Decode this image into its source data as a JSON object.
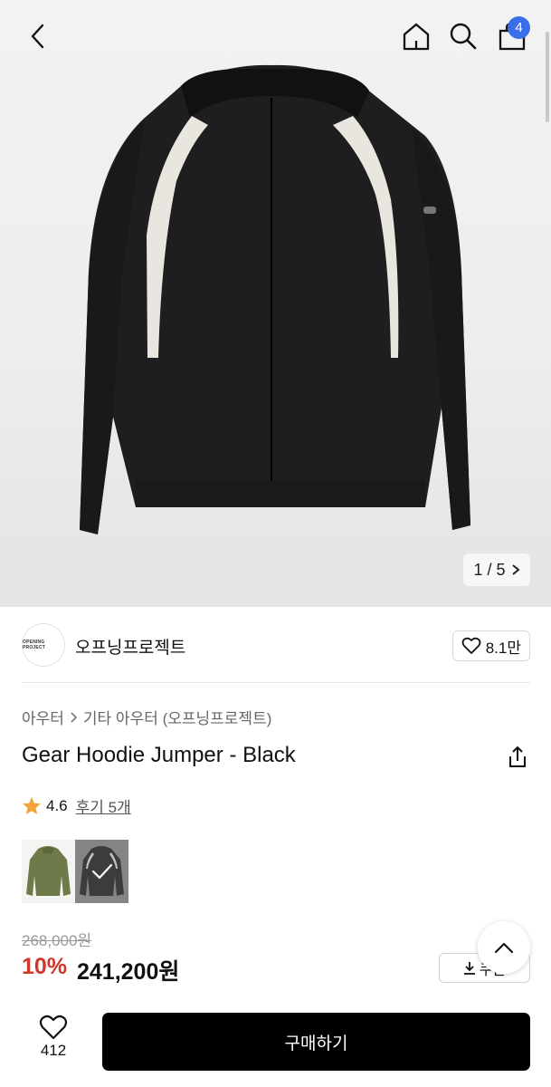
{
  "header": {
    "back_icon": "chevron-left-icon",
    "home_icon": "home-icon",
    "search_icon": "search-icon",
    "cart_icon": "shopping-bag-icon",
    "cart_count": "4",
    "badge_color": "#3a6de8"
  },
  "gallery": {
    "pager_text": "1 / 5",
    "current": 1,
    "total": 5
  },
  "brand": {
    "name": "오프닝프로젝트",
    "logo_text": "OPENING PROJECT",
    "likes": "8.1만"
  },
  "breadcrumb": {
    "items": [
      "아우터",
      "기타 아우터 (오프닝프로젝트)"
    ]
  },
  "product": {
    "title": "Gear Hoodie Jumper - Black",
    "rating": "4.6",
    "reviews_label": "후기 5개",
    "star_color": "#f2a33a"
  },
  "price": {
    "original": "268,000원",
    "discount": "10%",
    "final": "241,200원",
    "discount_color": "#d0362b"
  },
  "actions": {
    "coupon_label": "쿠폰",
    "wish_count": "412",
    "buy_label": "구매하기"
  }
}
